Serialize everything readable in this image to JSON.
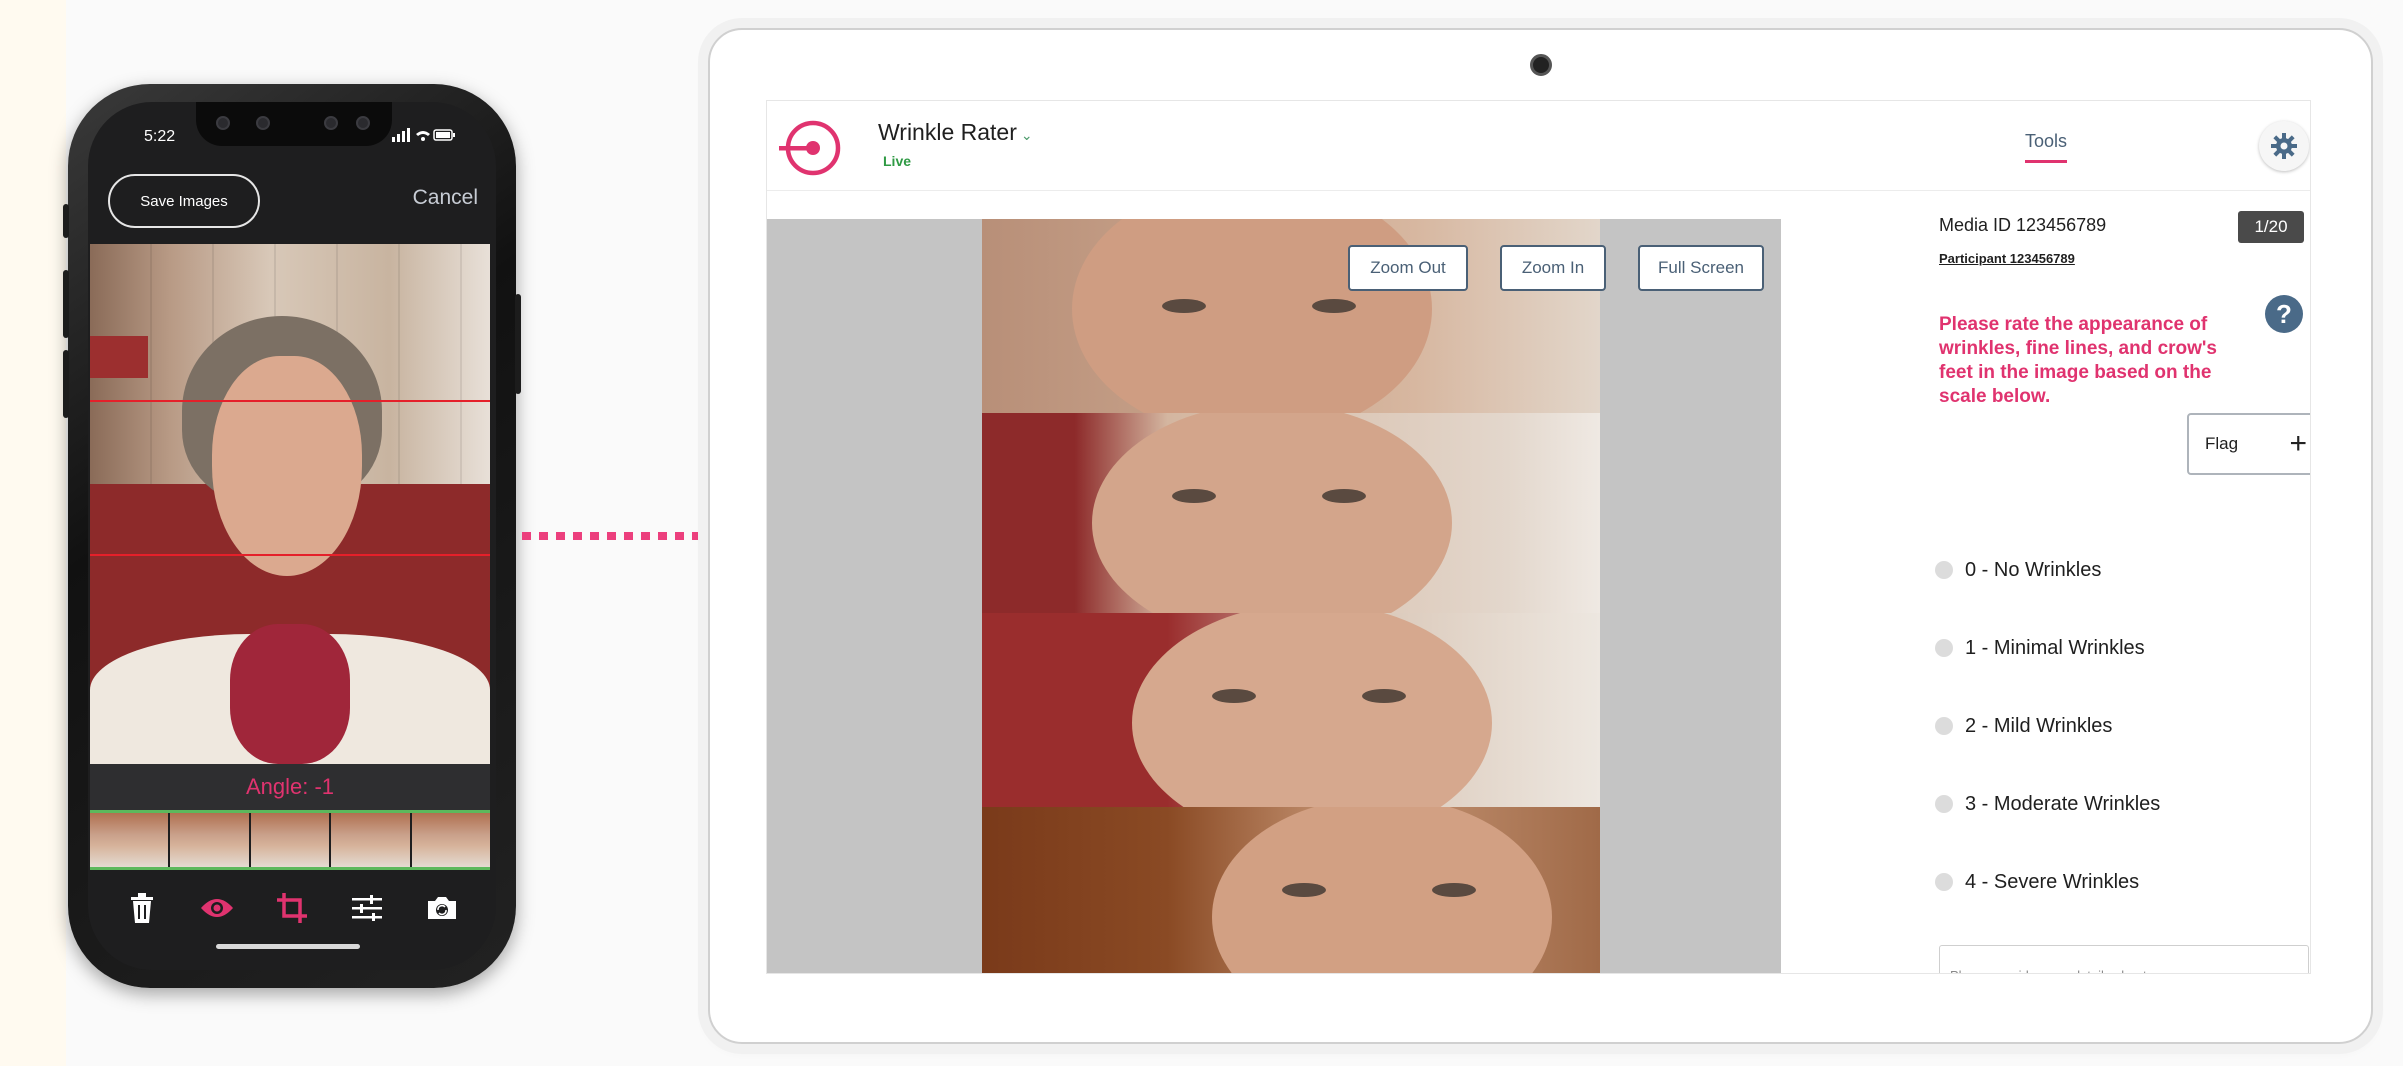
{
  "phone": {
    "status_time": "5:22",
    "save_images_label": "Save Images",
    "cancel_label": "Cancel",
    "angle_text": "Angle: -1",
    "toolbar_icons": [
      "trash-icon",
      "eye-icon",
      "crop-icon",
      "sliders-icon",
      "camera-rotate-icon"
    ],
    "accent_color": "#e0336f"
  },
  "app": {
    "title": "Wrinkle Rater",
    "status": "Live",
    "tools_tab": "Tools",
    "viewer": {
      "zoom_out_label": "Zoom Out",
      "zoom_in_label": "Zoom In",
      "full_screen_label": "Full Screen"
    },
    "panel": {
      "media_id": "Media ID 123456789",
      "counter": "1/20",
      "participant": "Participant 123456789",
      "help_label": "?",
      "instructions": "Please rate the appearance of wrinkles, fine lines, and crow's feet in the image based on the scale below.",
      "flag_label": "Flag",
      "options": [
        "0 - No Wrinkles",
        "1 - Minimal Wrinkles",
        "2 - Mild Wrinkles",
        "3 - Moderate Wrinkles",
        "4 - Severe Wrinkles"
      ],
      "details_placeholder": "Please provide more details about your response"
    },
    "accent_color": "#e0336f",
    "live_color": "#2f9a44"
  }
}
